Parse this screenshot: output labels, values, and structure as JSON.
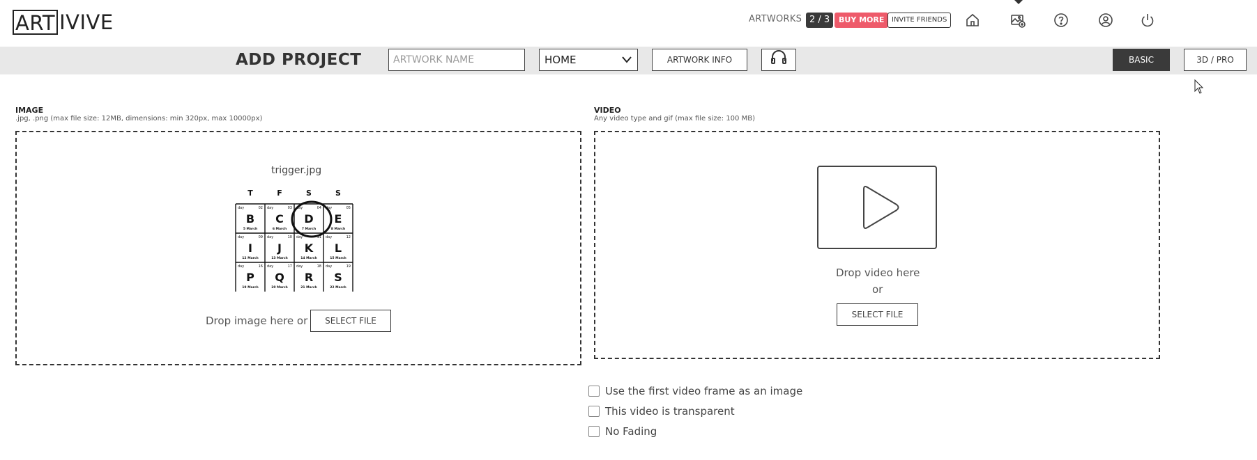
{
  "header": {
    "logo_boxed": "ART",
    "logo_rest": "IVIVE",
    "artworks_label": "ARTWORKS",
    "artworks_count": "2 / 3",
    "buy_more": "BUY MORE",
    "invite_friends": "INVITE FRIENDS",
    "icons": [
      "home-icon",
      "add-artwork-icon",
      "help-icon",
      "user-icon",
      "power-icon"
    ]
  },
  "project_bar": {
    "title": "ADD PROJECT",
    "artwork_name_placeholder": "ARTWORK NAME",
    "location_select": "HOME",
    "artwork_info": "ARTWORK INFO",
    "mode_basic": "BASIC",
    "mode_pro": "3D / PRO"
  },
  "image_section": {
    "title": "IMAGE",
    "subtitle": ".jpg, .png (max file size: 12MB, dimensions: min 320px, max 10000px)",
    "filename": "trigger.jpg",
    "drop_text": "Drop image here or",
    "select_file": "SELECT FILE"
  },
  "video_section": {
    "title": "VIDEO",
    "subtitle": "Any video type and gif (max file size: 100 MB)",
    "drop_text": "Drop video here",
    "or_text": "or",
    "select_file": "SELECT FILE"
  },
  "options": [
    {
      "label": "Use the first video frame as an image",
      "checked": false
    },
    {
      "label": "This video is transparent",
      "checked": false
    },
    {
      "label": "No Fading",
      "checked": false
    }
  ],
  "calendar": {
    "headers": [
      "T",
      "F",
      "S",
      "S"
    ],
    "rows": [
      [
        {
          "day": "02",
          "letter": "B",
          "date": "5 March"
        },
        {
          "day": "03",
          "letter": "C",
          "date": "6 March"
        },
        {
          "day": "04",
          "letter": "D",
          "date": "7 March"
        },
        {
          "day": "05",
          "letter": "E",
          "date": "8 March"
        }
      ],
      [
        {
          "day": "09",
          "letter": "I",
          "date": "12 March"
        },
        {
          "day": "10",
          "letter": "J",
          "date": "13 March"
        },
        {
          "day": "11",
          "letter": "K",
          "date": "14 March"
        },
        {
          "day": "12",
          "letter": "L",
          "date": "15 March"
        }
      ],
      [
        {
          "day": "16",
          "letter": "P",
          "date": "19 March"
        },
        {
          "day": "17",
          "letter": "Q",
          "date": "20 March"
        },
        {
          "day": "18",
          "letter": "R",
          "date": "21 March"
        },
        {
          "day": "19",
          "letter": "S",
          "date": "22 March"
        }
      ]
    ],
    "day_prefix": "day",
    "circled_letter": "D"
  },
  "colors": {
    "accent_red": "#ee5a6a",
    "dark": "#3a3a3a",
    "bar_bg": "#e8e8e8"
  }
}
